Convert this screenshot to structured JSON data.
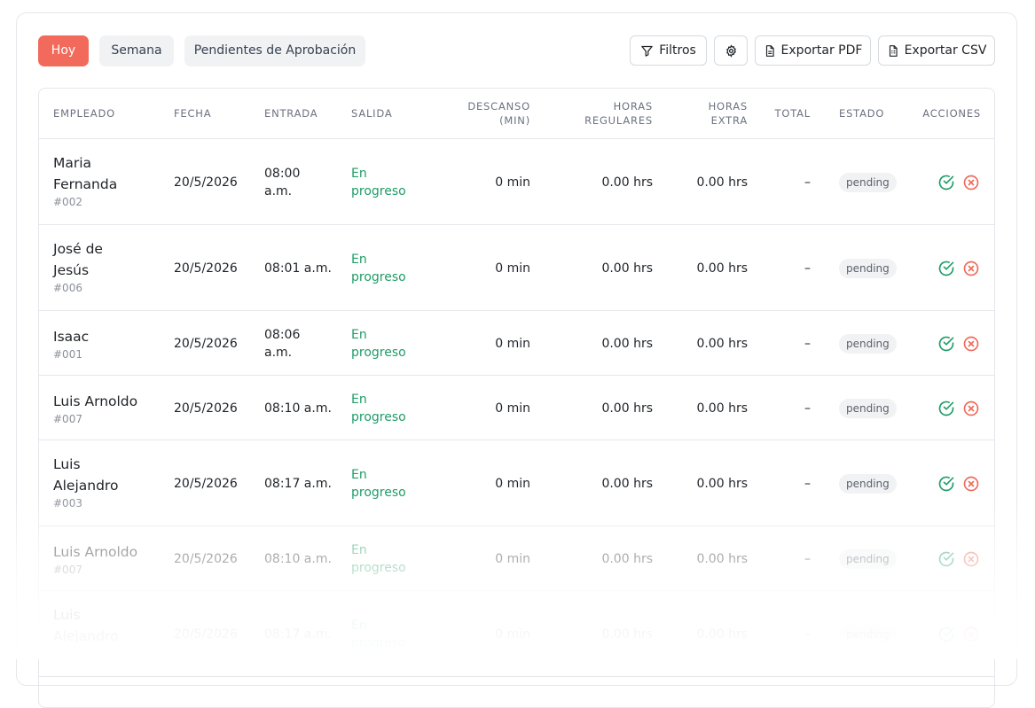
{
  "tabs": [
    {
      "label": "Hoy",
      "active": true
    },
    {
      "label": "Semana",
      "active": false
    },
    {
      "label": "Pendientes de Aprobación",
      "active": false
    }
  ],
  "toolbar": {
    "filters_label": "Filtros",
    "settings_icon": "gear-icon",
    "export_pdf_label": "Exportar PDF",
    "export_csv_label": "Exportar CSV"
  },
  "columns": {
    "empleado": "EMPLEADO",
    "fecha": "FECHA",
    "entrada": "ENTRADA",
    "salida": "SALIDA",
    "descanso_1": "DESCANSO",
    "descanso_2": "(MIN)",
    "regulares_1": "HORAS",
    "regulares_2": "REGULARES",
    "extra_1": "HORAS",
    "extra_2": "EXTRA",
    "total": "TOTAL",
    "estado": "ESTADO",
    "acciones": "ACCIONES"
  },
  "rows": [
    {
      "name_1": "Maria",
      "name_2": "Fernanda",
      "id": "#002",
      "fecha": "20/5/2026",
      "entrada_1": "08:00",
      "entrada_2": "a.m.",
      "salida_1": "En",
      "salida_2": "progreso",
      "descanso": "0 min",
      "regulares": "0.00 hrs",
      "extra": "0.00 hrs",
      "total": "–",
      "estado": "pending"
    },
    {
      "name_1": "José de",
      "name_2": "Jesús",
      "id": "#006",
      "fecha": "20/5/2026",
      "entrada_1": "08:01 a.m.",
      "entrada_2": "",
      "salida_1": "En",
      "salida_2": "progreso",
      "descanso": "0 min",
      "regulares": "0.00 hrs",
      "extra": "0.00 hrs",
      "total": "–",
      "estado": "pending"
    },
    {
      "name_1": "Isaac",
      "name_2": "",
      "id": "#001",
      "fecha": "20/5/2026",
      "entrada_1": "08:06",
      "entrada_2": "a.m.",
      "salida_1": "En",
      "salida_2": "progreso",
      "descanso": "0 min",
      "regulares": "0.00 hrs",
      "extra": "0.00 hrs",
      "total": "–",
      "estado": "pending"
    },
    {
      "name_1": "Luis Arnoldo",
      "name_2": "",
      "id": "#007",
      "fecha": "20/5/2026",
      "entrada_1": "08:10 a.m.",
      "entrada_2": "",
      "salida_1": "En",
      "salida_2": "progreso",
      "descanso": "0 min",
      "regulares": "0.00 hrs",
      "extra": "0.00 hrs",
      "total": "–",
      "estado": "pending"
    },
    {
      "name_1": "Luis",
      "name_2": "Alejandro",
      "id": "#003",
      "fecha": "20/5/2026",
      "entrada_1": "08:17 a.m.",
      "entrada_2": "",
      "salida_1": "En",
      "salida_2": "progreso",
      "descanso": "0 min",
      "regulares": "0.00 hrs",
      "extra": "0.00 hrs",
      "total": "–",
      "estado": "pending"
    },
    {
      "name_1": "Luis Arnoldo",
      "name_2": "",
      "id": "#007",
      "fecha": "20/5/2026",
      "entrada_1": "08:10 a.m.",
      "entrada_2": "",
      "salida_1": "En",
      "salida_2": "progreso",
      "descanso": "0 min",
      "regulares": "0.00 hrs",
      "extra": "0.00 hrs",
      "total": "–",
      "estado": "pending"
    },
    {
      "name_1": "Luis",
      "name_2": "Alejandro",
      "id": "#003",
      "fecha": "20/5/2026",
      "entrada_1": "08:17 a.m.",
      "entrada_2": "",
      "salida_1": "En",
      "salida_2": "progreso",
      "descanso": "0 min",
      "regulares": "0.00 hrs",
      "extra": "0.00 hrs",
      "total": "–",
      "estado": "pending"
    }
  ],
  "colors": {
    "accent": "#f26a5b",
    "approve": "#1f9d67",
    "reject": "#ef6a5a"
  }
}
